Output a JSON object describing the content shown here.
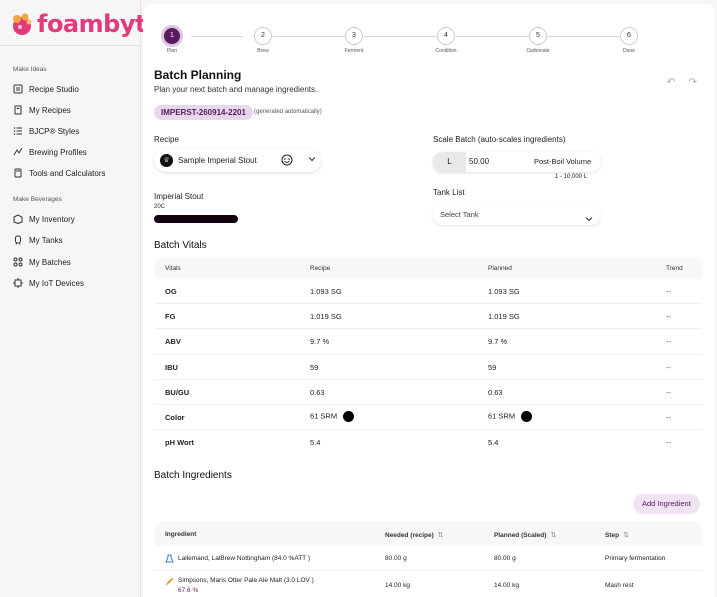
{
  "brand": {
    "name": "foambyte",
    "accent": "#5a1a5e",
    "logo_color": "#e23a7a"
  },
  "sidebar": {
    "sections": [
      {
        "title": "Make Ideas",
        "items": [
          {
            "label": "Recipe Studio",
            "icon": "recipe-studio-icon"
          },
          {
            "label": "My Recipes",
            "icon": "recipes-book-icon"
          },
          {
            "label": "BJCP® Styles",
            "icon": "list-icon"
          },
          {
            "label": "Brewing Profiles",
            "icon": "profiles-icon"
          },
          {
            "label": "Tools and Calculators",
            "icon": "calculator-icon"
          }
        ]
      },
      {
        "title": "Make Beverages",
        "items": [
          {
            "label": "My Inventory",
            "icon": "inventory-box-icon"
          },
          {
            "label": "My Tanks",
            "icon": "tanks-icon"
          },
          {
            "label": "My Batches",
            "icon": "batches-icon"
          },
          {
            "label": "My IoT Devices",
            "icon": "iot-icon"
          }
        ]
      }
    ]
  },
  "stepper": {
    "steps": [
      {
        "num": "1",
        "label": "Plan",
        "active": true
      },
      {
        "num": "2",
        "label": "Brew"
      },
      {
        "num": "3",
        "label": "Ferment"
      },
      {
        "num": "4",
        "label": "Condition"
      },
      {
        "num": "5",
        "label": "Carbonate"
      },
      {
        "num": "6",
        "label": "Done"
      }
    ]
  },
  "page": {
    "title": "Batch Planning",
    "subtitle": "Plan your next batch and manage ingredients.",
    "batch_id": "IMPERST-260914-2201",
    "batch_id_note": "(generated automatically)"
  },
  "recipe": {
    "label": "Recipe",
    "selected": "Sample Imperial Stout",
    "style_name": "Imperial Stout",
    "style_code": "20C",
    "style_color": "#120010"
  },
  "scale": {
    "label": "Scale Batch (auto-scales ingredients)",
    "unit": "L",
    "value": "50.00",
    "volume_type": "Post-Boil Volume",
    "range": "1 - 10,000 L"
  },
  "tank": {
    "label": "Tank List",
    "placeholder": "Select Tank"
  },
  "vitals": {
    "heading": "Batch Vitals",
    "columns": [
      "Vitals",
      "Recipe",
      "Planned",
      "Trend"
    ],
    "rows": [
      {
        "name": "OG",
        "recipe": "1.093 SG",
        "planned": "1.093 SG",
        "trend": "--"
      },
      {
        "name": "FG",
        "recipe": "1.019 SG",
        "planned": "1.019 SG",
        "trend": "--"
      },
      {
        "name": "ABV",
        "recipe": "9.7 %",
        "planned": "9.7 %",
        "trend": "--"
      },
      {
        "name": "IBU",
        "recipe": "59",
        "planned": "59",
        "trend": "--"
      },
      {
        "name": "BU/GU",
        "recipe": "0.63",
        "planned": "0.63",
        "trend": "--"
      },
      {
        "name": "Color",
        "recipe": "61 SRM",
        "planned": "61 SRM",
        "trend": "--",
        "swatch": "#000000"
      },
      {
        "name": "pH Wort",
        "recipe": "5.4",
        "planned": "5.4",
        "trend": "--"
      }
    ]
  },
  "ingredients": {
    "heading": "Batch Ingredients",
    "add_label": "Add Ingredient",
    "columns": [
      "Ingredient",
      "Needed (recipe)",
      "Planned (Scaled)",
      "Step"
    ],
    "rows": [
      {
        "icon": "yeast-icon",
        "name": "Lallemand, LalBrew Nottingham (84.0 %ATT )",
        "needed": "80.00 g",
        "planned": "80.00 g",
        "step": "Primary fermentation"
      },
      {
        "icon": "grain-icon",
        "name": "Simpsons, Maris Otter Pale Ale Malt (3.0 LOV )",
        "pct": "67.6 %",
        "needed": "14.00 kg",
        "planned": "14.00 kg",
        "step": "Mash rest"
      }
    ]
  }
}
